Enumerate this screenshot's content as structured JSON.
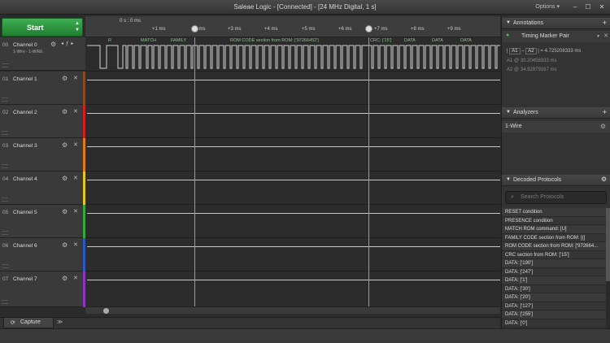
{
  "window": {
    "title": "Saleae Logic - [Connected] - [24 MHz Digital, 1 s]",
    "options_label": "Options ▾",
    "min": "–",
    "max": "☐",
    "close": "✕"
  },
  "start": {
    "label": "Start",
    "arrows_up": "▲",
    "arrows_down": "▼"
  },
  "channels": [
    {
      "num": "00",
      "name": "Channel 0",
      "sub": "1-Wire - 1-WIRE",
      "color": "#2b2b2b"
    },
    {
      "num": "01",
      "name": "Channel 1",
      "color": "#8b4a24"
    },
    {
      "num": "02",
      "name": "Channel 2",
      "color": "#d01f1f"
    },
    {
      "num": "03",
      "name": "Channel 3",
      "color": "#e07a12"
    },
    {
      "num": "04",
      "name": "Channel 4",
      "color": "#e6c81a"
    },
    {
      "num": "05",
      "name": "Channel 5",
      "color": "#37a83c"
    },
    {
      "num": "06",
      "name": "Channel 6",
      "color": "#2b58c9"
    },
    {
      "num": "07",
      "name": "Channel 7",
      "color": "#8a35c0"
    }
  ],
  "icons": {
    "gear": "⚙",
    "close": "✕",
    "pin": "📍",
    "search": "🔍"
  },
  "ruler": {
    "zero_label": "0 s : 0 ms",
    "ticks": [
      "+1 ms",
      "+2 ms",
      "+3 ms",
      "+4 ms",
      "+5 ms",
      "+6 ms",
      "+7 ms",
      "+8 ms",
      "+9 ms"
    ]
  },
  "decoder_lane": {
    "segments": [
      "R",
      "MATCH",
      "FAMILY",
      "ROM CODE section from ROM: ['97266452']",
      "CRC: ['15']",
      "DATA",
      "DATA",
      "DATA"
    ]
  },
  "tabs": {
    "capture": "Capture",
    "more": "≫"
  },
  "annotations": {
    "header": "Annotations",
    "add": "+",
    "marker_pair": "Timing Marker Pair",
    "a1_label": "A1",
    "a2_label": "A2",
    "delta": "= 4.725208333 ms",
    "a1_value": "@  30.20458333 ms",
    "a2_value": "@  34.92979167 ms"
  },
  "analyzers": {
    "header": "Analyzers",
    "add": "+",
    "items": [
      "1-Wire"
    ]
  },
  "decoded": {
    "header": "Decoded Protocols",
    "search_placeholder": "Search Protocols",
    "items": [
      "RESET condition",
      "PRESENCE condition",
      "MATCH ROM command: [U]",
      "FAMILY CODE section from ROM: [(]",
      "ROM CODE section from ROM: ['972664...",
      "CRC section from ROM: ['15']",
      "DATA: ['190']",
      "DATA: ['247']",
      "DATA: ['1']",
      "DATA: ['30']",
      "DATA: ['20']",
      "DATA: ['127']",
      "DATA: ['255']",
      "DATA: ['0']"
    ]
  }
}
